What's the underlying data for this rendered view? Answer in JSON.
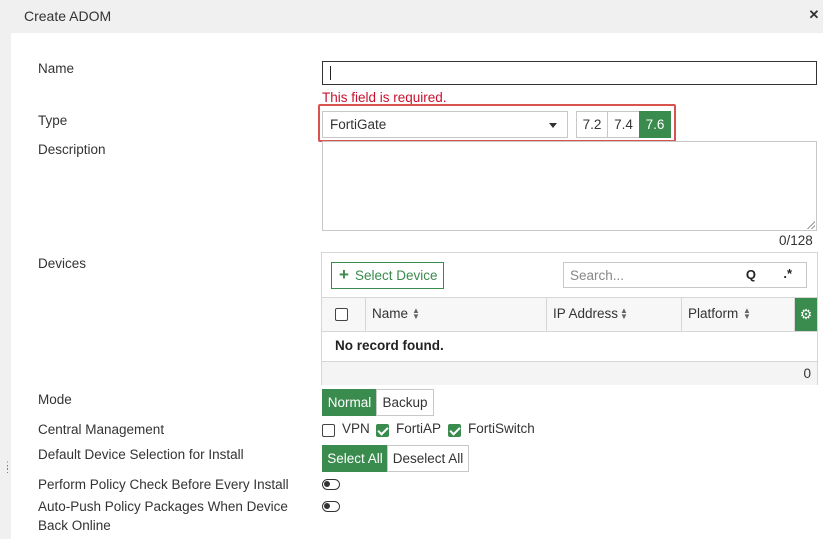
{
  "dialog": {
    "title": "Create ADOM",
    "close_icon": "close-icon"
  },
  "form": {
    "name": {
      "label": "Name",
      "value": "",
      "error": "This field is required."
    },
    "type": {
      "label": "Type",
      "selected": "FortiGate",
      "versions": [
        "7.2",
        "7.4",
        "7.6"
      ],
      "active_version": "7.6"
    },
    "description": {
      "label": "Description",
      "value": "",
      "counter": "0/128"
    },
    "devices": {
      "label": "Devices",
      "select_button": "Select Device",
      "search_placeholder": "Search...",
      "columns": [
        "Name",
        "IP Address",
        "Platform"
      ],
      "empty_message": "No record found.",
      "count": "0"
    },
    "mode": {
      "label": "Mode",
      "options": [
        "Normal",
        "Backup"
      ],
      "selected": "Normal"
    },
    "central_management": {
      "label": "Central Management",
      "options": [
        {
          "label": "VPN",
          "checked": false
        },
        {
          "label": "FortiAP",
          "checked": true
        },
        {
          "label": "FortiSwitch",
          "checked": true
        }
      ]
    },
    "default_device_selection": {
      "label": "Default Device Selection for Install",
      "options": [
        "Select All",
        "Deselect All"
      ],
      "selected": "Select All"
    },
    "policy_check": {
      "label": "Perform Policy Check Before Every Install",
      "enabled": false
    },
    "auto_push": {
      "label_line1": "Auto-Push Policy Packages When Device",
      "label_line2": "Back Online",
      "enabled": false
    }
  },
  "colors": {
    "accent": "#3a8b4e",
    "error": "#c8102e",
    "highlight_border": "#d9534f"
  }
}
